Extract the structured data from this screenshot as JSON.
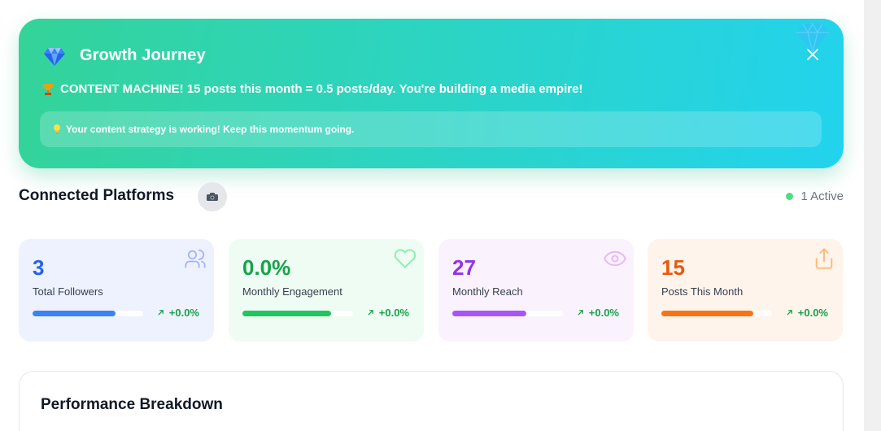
{
  "banner": {
    "title": "Growth Journey",
    "message": "CONTENT MACHINE! 15 posts this month = 0.5 posts/day. You're building a media empire!",
    "tip": "Your content strategy is working! Keep this momentum going.",
    "icons": {
      "title": "gem-icon",
      "message": "trophy-icon",
      "tip": "lightbulb-icon",
      "close": "close-icon"
    }
  },
  "platforms": {
    "title": "Connected Platforms",
    "status": "1 Active",
    "icon": "camera-icon"
  },
  "stats": [
    {
      "value": "3",
      "label": "Total Followers",
      "trend": "+0.0%",
      "progress": 0.75,
      "color": "#2563eb",
      "bar_color": "#3b82f6",
      "icon": "users-icon"
    },
    {
      "value": "0.0%",
      "label": "Monthly Engagement",
      "trend": "+0.0%",
      "progress": 0.8,
      "color": "#16a34a",
      "bar_color": "#22c55e",
      "icon": "heart-icon"
    },
    {
      "value": "27",
      "label": "Monthly Reach",
      "trend": "+0.0%",
      "progress": 0.67,
      "color": "#9333ea",
      "bar_color": "#a855f7",
      "icon": "eye-icon"
    },
    {
      "value": "15",
      "label": "Posts This Month",
      "trend": "+0.0%",
      "progress": 0.83,
      "color": "#ea580c",
      "bar_color": "#f97316",
      "icon": "share-icon"
    }
  ],
  "performance": {
    "title": "Performance Breakdown"
  }
}
